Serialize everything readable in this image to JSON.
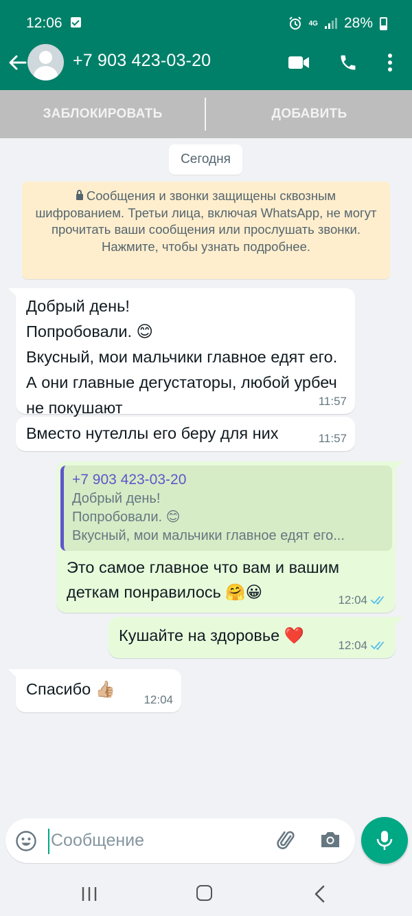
{
  "status_bar": {
    "time": "12:06",
    "network": "4G",
    "battery": "28%"
  },
  "header": {
    "contact_name": "+7 903 423-03-20"
  },
  "actions": {
    "block_label": "ЗАБЛОКИРОВАТЬ",
    "add_label": "ДОБАВИТЬ"
  },
  "chat": {
    "date_label": "Сегодня",
    "encryption_notice": "Сообщения и звонки защищены сквозным шифрованием. Третьи лица, включая WhatsApp, не могут прочитать ваши сообщения или прослушать звонки. Нажмите, чтобы узнать подробнее.",
    "messages": [
      {
        "direction": "incoming",
        "text": "Добрый день!\nПопробовали. 😊\nВкусный, мои мальчики главное едят его. А они главные дегустаторы, любой урбеч не покушают",
        "time": "11:57"
      },
      {
        "direction": "incoming",
        "text": "Вместо нутеллы его беру для них",
        "time": "11:57"
      },
      {
        "direction": "outgoing",
        "quote_author": "+7 903 423-03-20",
        "quote_text": "Добрый день!\nПопробовали. 😊\nВкусный, мои мальчики главное едят его...",
        "text": "Это самое главное что вам и вашим деткам понравилось 🤗😀",
        "time": "12:04",
        "status": "read"
      },
      {
        "direction": "outgoing",
        "text": "Кушайте на здоровье ❤️",
        "time": "12:04",
        "status": "read"
      },
      {
        "direction": "incoming",
        "text": "Спасибо 👍🏼",
        "time": "12:04"
      }
    ]
  },
  "composer": {
    "placeholder": "Сообщение"
  },
  "colors": {
    "header": "#008069",
    "accent": "#00a884",
    "outgoing_bubble": "#e7fbdb",
    "read_ticks": "#53bdeb"
  },
  "icons": [
    "back-arrow-icon",
    "avatar-icon",
    "video-call-icon",
    "phone-icon",
    "more-icon",
    "emoji-icon",
    "attach-icon",
    "camera-icon",
    "mic-icon",
    "lock-icon"
  ]
}
